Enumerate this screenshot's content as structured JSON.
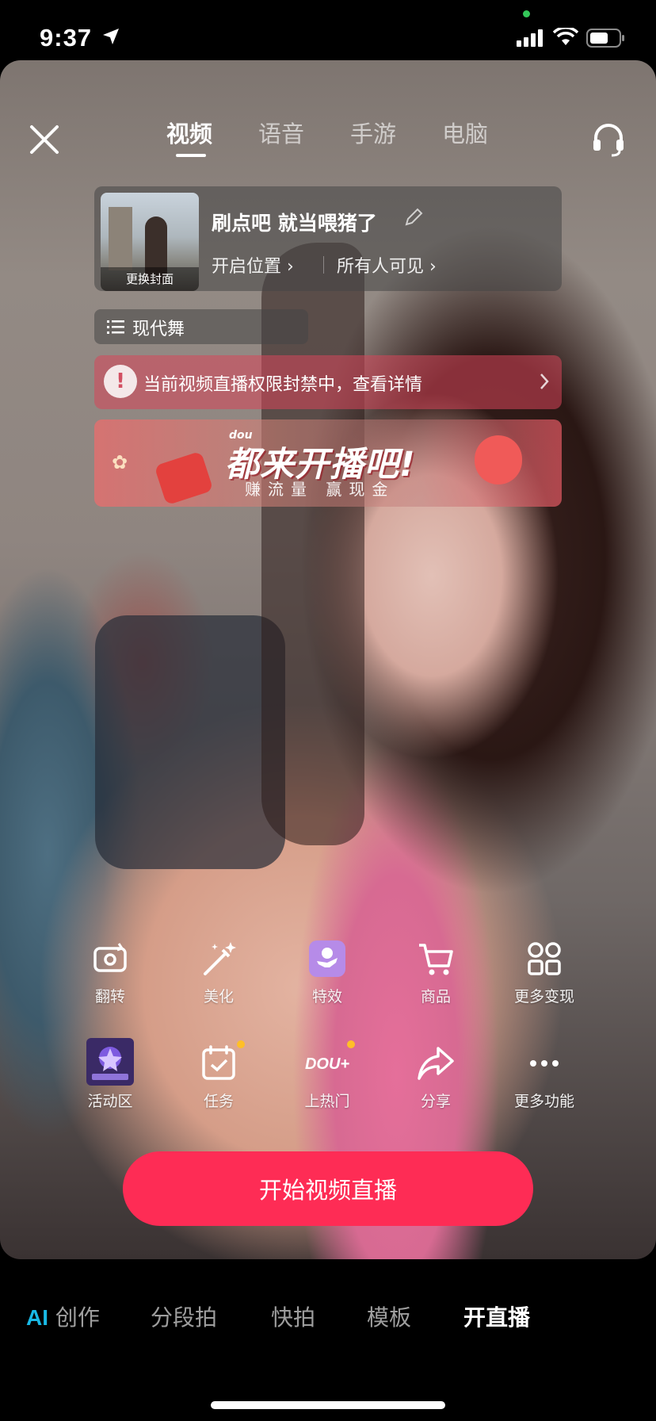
{
  "status_bar": {
    "time": "9:37"
  },
  "top_bar": {
    "tabs": [
      {
        "label": "视频",
        "active": true
      },
      {
        "label": "语音",
        "active": false
      },
      {
        "label": "手游",
        "active": false
      },
      {
        "label": "电脑",
        "active": false
      }
    ]
  },
  "live_info": {
    "cover_label": "更换封面",
    "title": "刷点吧 就当喂猪了",
    "location": "开启位置",
    "visibility": "所有人可见",
    "category": "现代舞"
  },
  "alert": {
    "text": "当前视频直播权限封禁中，查看详情"
  },
  "banner": {
    "brand": "dou",
    "headline": "都来开播吧!",
    "subline": "赚流量 赢现金"
  },
  "tools_row1": [
    {
      "label": "翻转",
      "icon": "flip-camera-icon"
    },
    {
      "label": "美化",
      "icon": "magic-wand-icon"
    },
    {
      "label": "特效",
      "icon": "effects-icon"
    },
    {
      "label": "商品",
      "icon": "shopping-cart-icon"
    },
    {
      "label": "更多变现",
      "icon": "apps-grid-icon"
    }
  ],
  "tools_row2": [
    {
      "label": "活动区",
      "icon": "event-badge-icon"
    },
    {
      "label": "任务",
      "icon": "task-calendar-icon"
    },
    {
      "label": "上热门",
      "icon": "dou-plus-icon",
      "icon_text": "DOU+"
    },
    {
      "label": "分享",
      "icon": "share-arrow-icon"
    },
    {
      "label": "更多功能",
      "icon": "more-dots-icon"
    }
  ],
  "start_button": {
    "label": "开始视频直播"
  },
  "modes": [
    {
      "prefix": "AI",
      "label": "创作",
      "active": false
    },
    {
      "label": "分段拍",
      "active": false
    },
    {
      "label": "快拍",
      "active": false
    },
    {
      "label": "模板",
      "active": false
    },
    {
      "label": "开直播",
      "active": true
    }
  ],
  "colors": {
    "accent": "#fe2c55",
    "ai_blue": "#19b9e6",
    "badge_dot": "#ffbf27"
  }
}
